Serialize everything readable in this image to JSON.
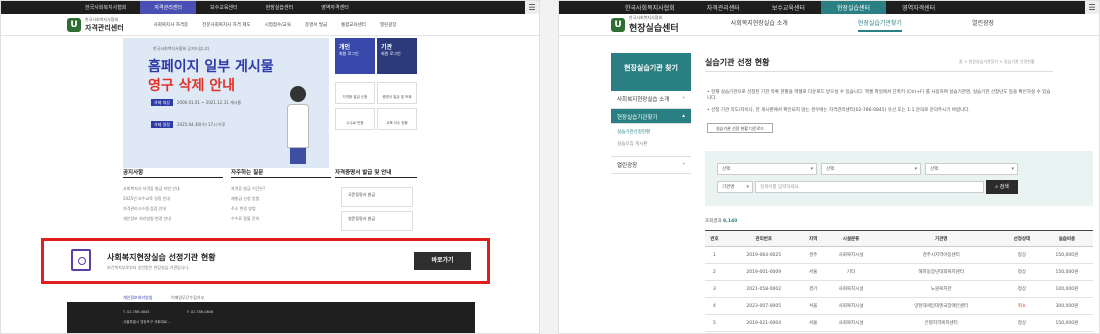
{
  "left": {
    "topbar": {
      "tabs": [
        "한국사회복지사협회",
        "자격관리센터",
        "보수교육센터",
        "현장실습센터",
        "영역자격센터"
      ],
      "active": 1
    },
    "logo": {
      "sub": "한국사회복지사협회",
      "name": "자격관리센터"
    },
    "gnav": [
      "사회복지사 자격증",
      "전문사회복지사 자격 제도",
      "시험접수/교육",
      "증명서 발급",
      "통합교육센터",
      "열린광장"
    ],
    "hero": {
      "kicker": "한국사회복지사협회 공지드립니다",
      "title_blue": "홈페이지 일부 게시물",
      "title_red": "영구 삭제 안내",
      "row1_label": "삭제 대상",
      "row1_text": "2006.01.01 ~ 2021.12.31 게시물",
      "row2_label": "삭제 일정",
      "row2_text": "2025.04.30(수) 17시 이후"
    },
    "cards": {
      "personal": {
        "title": "개인",
        "sub": "회원 로그인"
      },
      "agency": {
        "title": "기관",
        "sub": "회원 로그인"
      },
      "small": [
        "자격증 발급 신청",
        "증명서 발급 및 조회",
        "수수료 반환",
        "교육 이수 현황"
      ]
    },
    "sections": {
      "notice": "공지사항",
      "faq": "자주하는 질문",
      "cert": "자격증명서 발급 및 안내"
    },
    "notice_items": [
      "사회복지사 자격증 발급 지연 안내",
      "2025년 보수교육 일정 안내",
      "자격관리시스템 점검 안내",
      "개인정보 처리방침 변경 안내"
    ],
    "faq_items": [
      "자격증 발급 기간은?",
      "재발급 신청 방법",
      "주소 변경 방법",
      "수수료 환불 문의"
    ],
    "cert_items": [
      "국문증명서 발급",
      "영문증명서 발급"
    ],
    "highlight": {
      "title": "사회복지현장실습 선정기관 현황",
      "sub": "보건복지부로부터 승인받은 현장실습 기관입니다.",
      "button": "바로가기"
    },
    "footer_links": [
      "개인정보처리방침",
      "이메일무단수집거부"
    ],
    "footer_lines": [
      "T. 02-786-0845",
      "F. 02-786-0846",
      "서울특별시 영등포구 국회대로 ..."
    ]
  },
  "right": {
    "topbar": {
      "tabs": [
        "한국사회복지사협회",
        "자격관리센터",
        "보수교육센터",
        "현장실습센터",
        "영역자격센터"
      ],
      "active": 3
    },
    "logo": {
      "sub": "한국사회복지사협회",
      "name": "현장실습센터"
    },
    "gnav": [
      "사회복지현장실습 소개",
      "현장실습기관찾기",
      "열린광장"
    ],
    "gnav_active": 1,
    "lnb": {
      "head": "현장실습기관 찾기",
      "items": [
        "사회복지현장실습 소개",
        "현장실습기관찾기",
        "열린광장"
      ],
      "subs": [
        "실습기관선정현황",
        "실습모집 게시판"
      ]
    },
    "title": "실습기관 선정 현황",
    "breadcrumb": "홈 > 현장실습기관찾기 > 실습기관 선정현황",
    "notices": [
      "현재 실습기관으로 선정된 기관 목록 현황을 엑셀로 다운로드 받으실 수 있습니다. 엑셀 파일에서 단축키 (Ctrl+F) 를 사용하여 실습기관명, 실습기관 선정년도 등을 확인하실 수 있습니다.",
      "선정 기관 지도/자이나, 한 게시판에서 확인되지 않는 경우에는 자격관리센터(02-786-0845) 유선 또는 1:1 문의로 문의주시기 바랍니다."
    ],
    "download_button": "실습기관 선정 현황 다운로드",
    "search": {
      "selects": [
        "선택",
        "선택",
        "선택"
      ],
      "keyword_select": "기관명",
      "placeholder": "검색어를 입력하세요.",
      "button": "검색"
    },
    "total_label": "조회결과",
    "total_value": "8,140",
    "table": {
      "headers": [
        "번호",
        "관리번호",
        "지역",
        "시설분류",
        "기관명",
        "선정상태",
        "실습비용"
      ],
      "rows": [
        [
          "1",
          "2019-064-0025",
          "경주",
          "사회복지시설",
          "경주시지역아동센터",
          "정상",
          "150,000원"
        ],
        [
          "2",
          "2019-001-0009",
          "서울",
          "기타",
          "해피동장년대외복지센터",
          "정상",
          "150,000원"
        ],
        [
          "3",
          "2021-058-0002",
          "경기",
          "사회복지시설",
          "노원복지관",
          "정상",
          "100,000원"
        ],
        [
          "4",
          "2023-007-0005",
          "서울",
          "사회복지시설",
          "양천대세민대엔국장애인센터",
          "취소",
          "300,000원"
        ],
        [
          "5",
          "2019-021-0004",
          "서울",
          "사회복지시설",
          "은평지역복지센터",
          "정상",
          "150,000원"
        ]
      ],
      "status_cancel": "취소"
    }
  },
  "colors": {
    "left_accent": "#4a4fb3",
    "right_accent": "#2a7f82",
    "highlight_border": "#e01e1e",
    "cancel": "#e0332b"
  }
}
